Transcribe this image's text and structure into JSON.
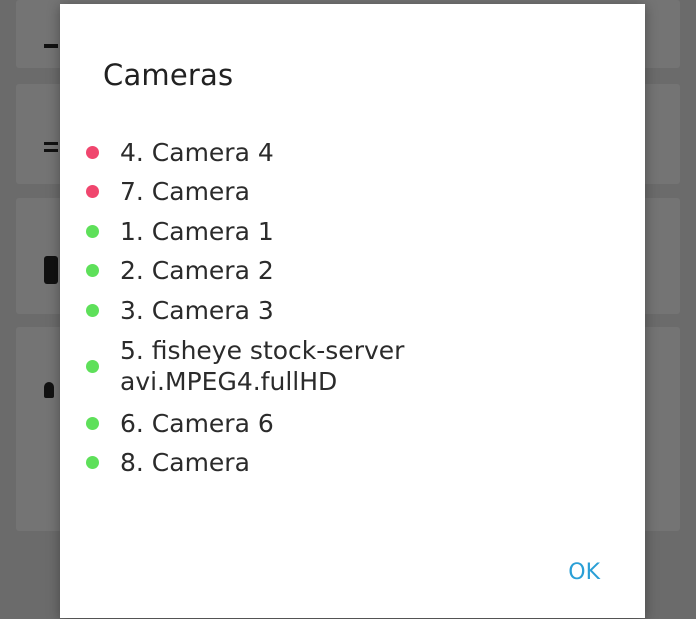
{
  "dialog": {
    "title": "Cameras",
    "ok_label": "OK"
  },
  "colors": {
    "offline": "#f0466e",
    "online": "#5ee05a",
    "accent": "#2a9fd6"
  },
  "cameras": [
    {
      "label": "4. Camera 4",
      "status": "offline"
    },
    {
      "label": "7. Camera",
      "status": "offline"
    },
    {
      "label": "1. Camera 1",
      "status": "online"
    },
    {
      "label": "2. Camera 2",
      "status": "online"
    },
    {
      "label": "3. Camera 3",
      "status": "online"
    },
    {
      "label": "5. fisheye stock-server avi.MPEG4.fullHD",
      "status": "online"
    },
    {
      "label": "6. Camera 6",
      "status": "online"
    },
    {
      "label": "8. Camera",
      "status": "online"
    }
  ]
}
